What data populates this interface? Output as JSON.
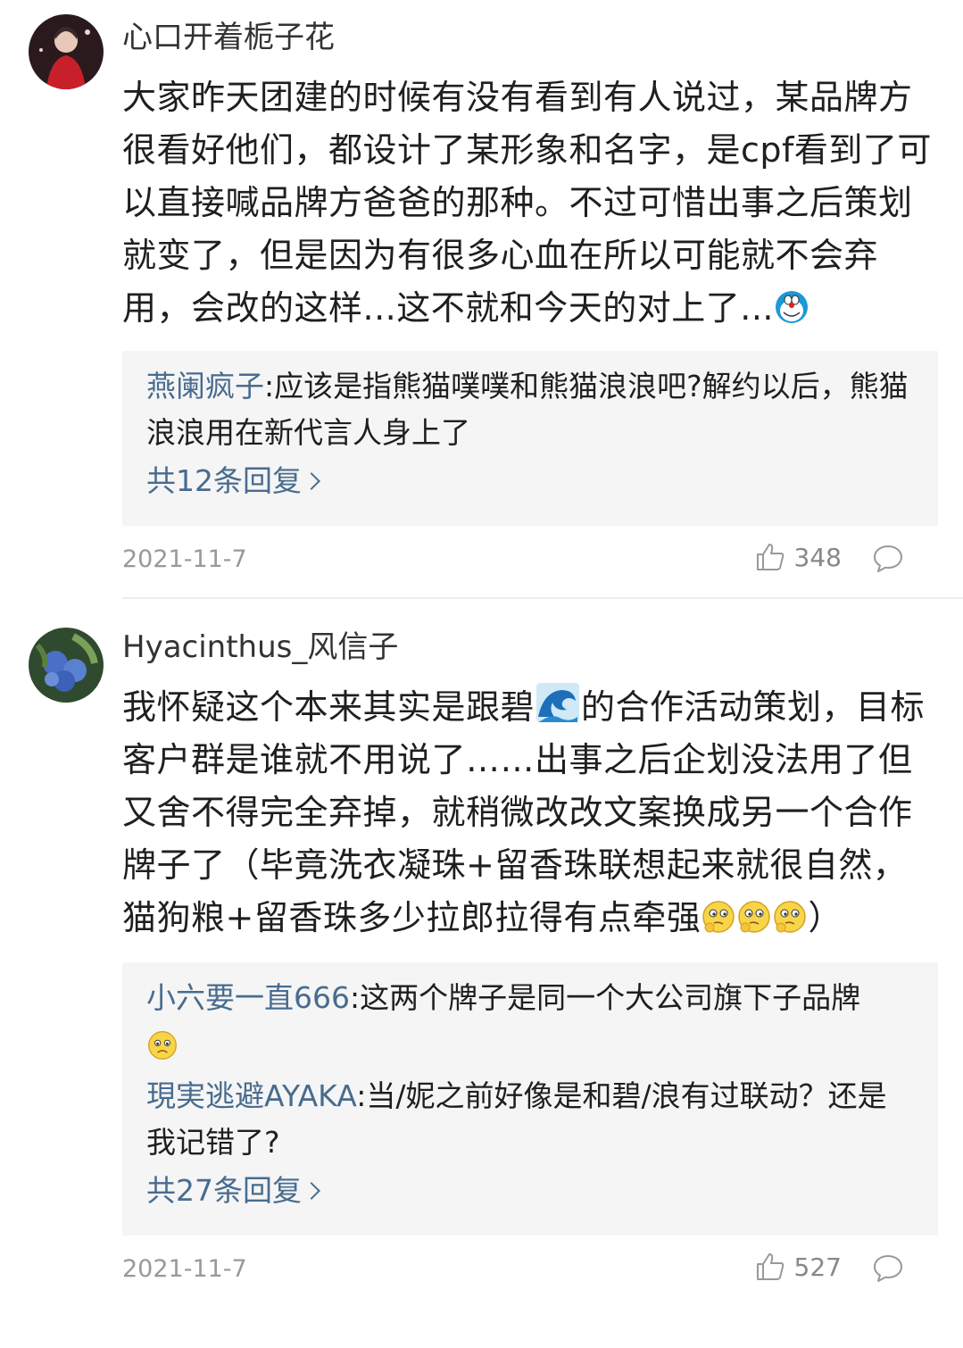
{
  "comments": [
    {
      "username": "心口开着栀子花",
      "text": "大家昨天团建的时候有没有看到有人说过，某品牌方很看好他们，都设计了某形象和名字，是cpf看到了可以直接喊品牌方爸爸的那种。不过可惜出事之后策划就变了，但是因为有很多心血在所以可能就不会弃用，会改的这样...这不就和今天的对上了...",
      "emoji": "doraemon-emoji",
      "replies": [
        {
          "name": "燕阑疯子",
          "text": ":应该是指熊猫噗噗和熊猫浪浪吧?解约以后，熊猫浪浪用在新代言人身上了"
        }
      ],
      "more": "共12条回复",
      "date": "2021-11-7",
      "likes": "348"
    },
    {
      "username": "Hyacinthus_风信子",
      "text_a": "我怀疑这个本来其实是跟碧",
      "text_b": "的合作活动策划，目标客户群是谁就不用说了……出事之后企划没法用了但又舍不得完全弃掉，就稍微改改文案换成另一个合作牌子了（毕竟洗衣凝珠+留香珠联想起来就很自然，猫狗粮+留香珠多少拉郎拉得有点牵强",
      "text_c": "）",
      "replies": [
        {
          "name": "小六要一直666",
          "text": ":这两个牌子是同一个大公司旗下子品牌"
        },
        {
          "name": "現実逃避AYAKA",
          "text": ":当/妮之前好像是和碧/浪有过联动？还是我记错了?"
        }
      ],
      "more": "共27条回复",
      "date": "2021-11-7",
      "likes": "527"
    }
  ]
}
